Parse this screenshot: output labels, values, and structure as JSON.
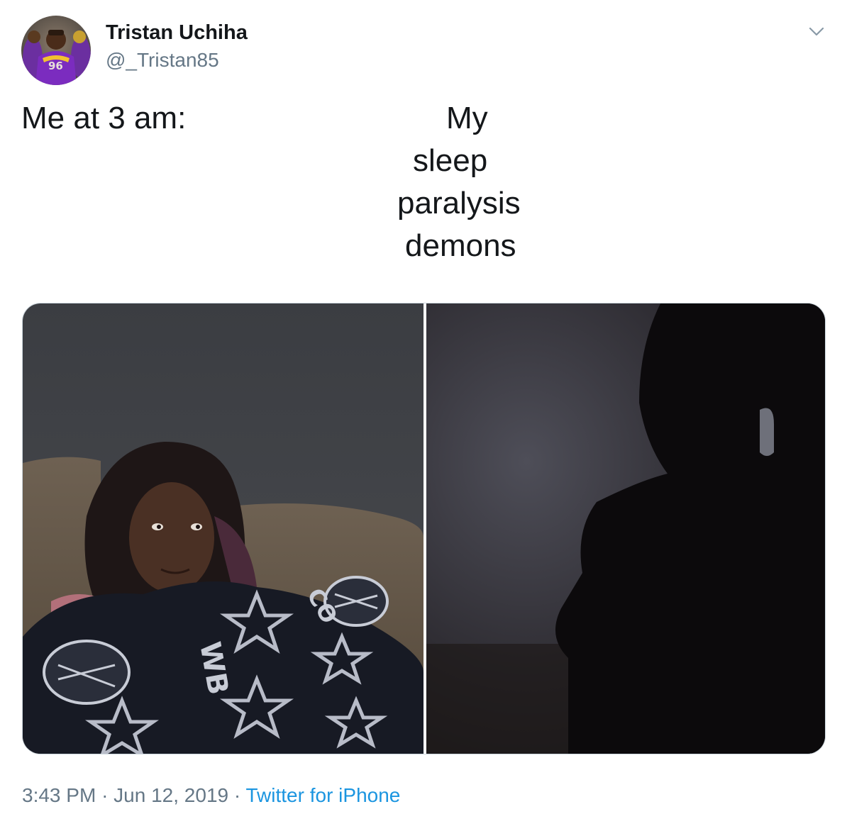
{
  "author": {
    "display_name": "Tristan Uchiha",
    "handle": "@_Tristan85",
    "avatar_jersey_number": "96"
  },
  "tweet": {
    "left_caption": "Me at 3 am:",
    "right_caption_lines": [
      "My",
      "sleep",
      "paralysis",
      "demons"
    ]
  },
  "meta": {
    "time": "3:43 PM",
    "separator": "·",
    "date": "Jun 12, 2019",
    "source": "Twitter for iPhone"
  },
  "icons": {
    "menu": "chevron-down-icon"
  },
  "colors": {
    "text_primary": "#14171a",
    "text_secondary": "#657786",
    "link": "#1b95e0",
    "border": "#ccd6dd"
  }
}
